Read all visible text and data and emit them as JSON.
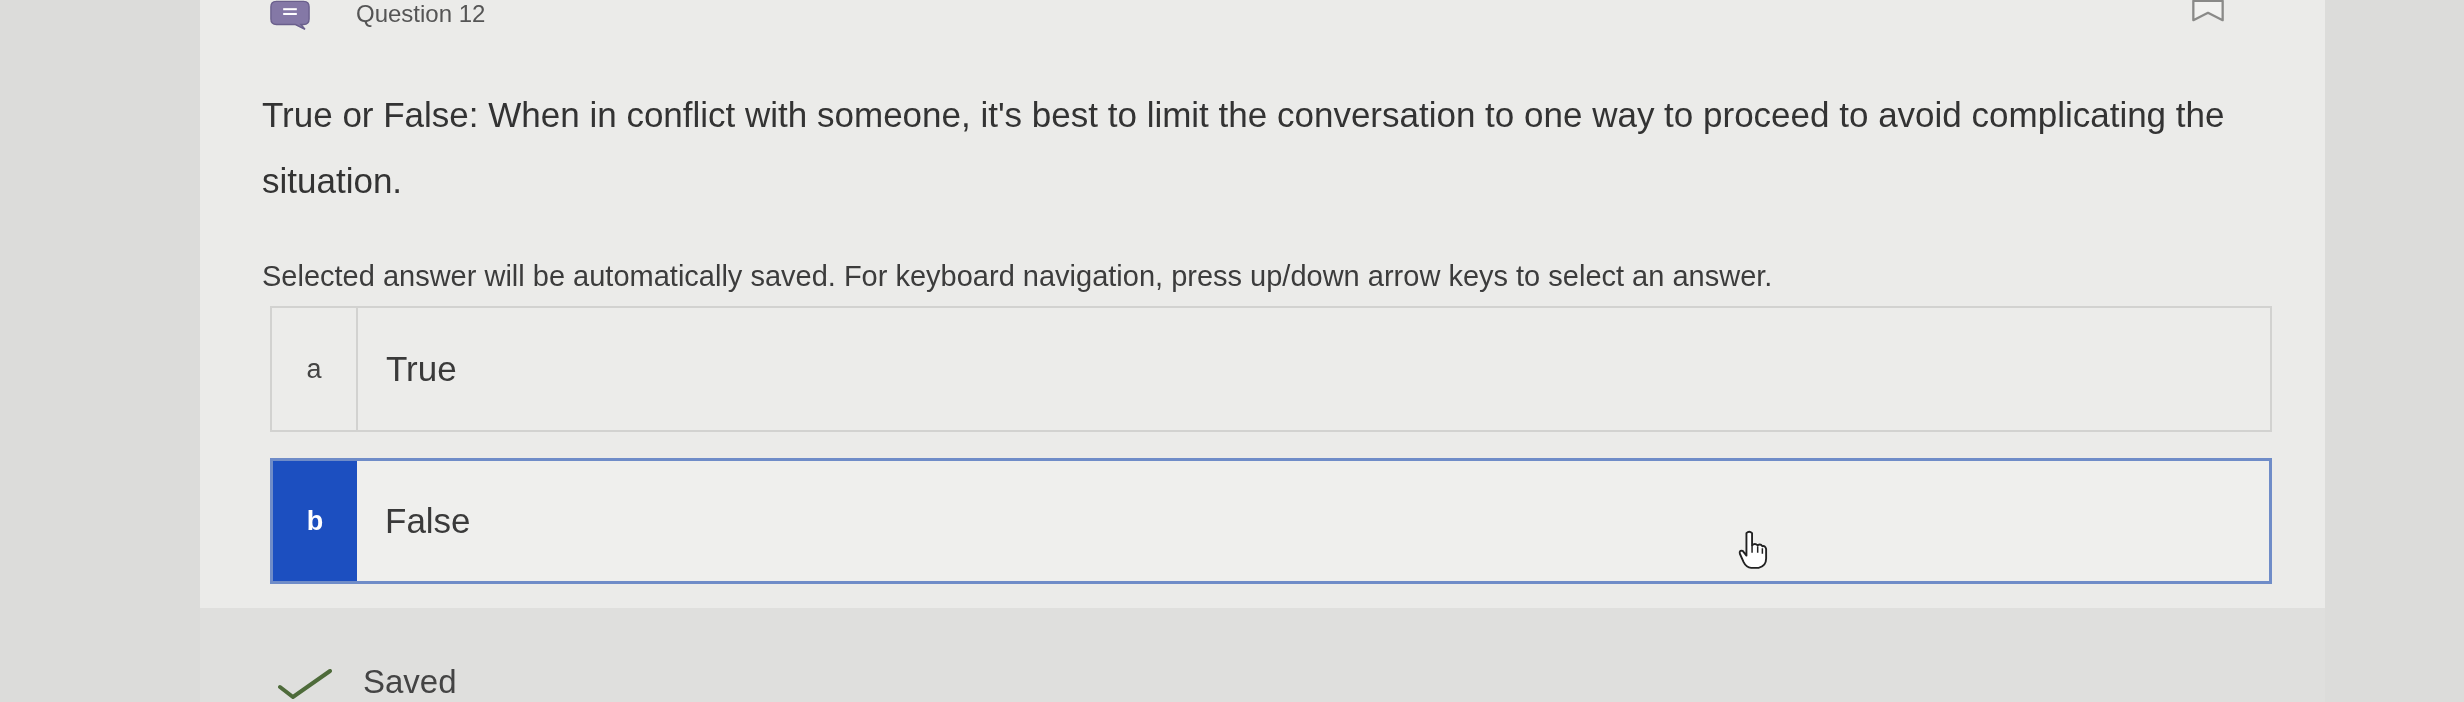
{
  "header": {
    "title": "Question 12"
  },
  "question": {
    "prompt": "True or False: When in conflict with someone, it's best to limit the conversation to one way to proceed to avoid complicating the situation.",
    "instructions": "Selected answer will be automatically saved. For keyboard navigation, press up/down arrow keys to select an answer."
  },
  "options": [
    {
      "letter": "a",
      "label": "True",
      "selected": false
    },
    {
      "letter": "b",
      "label": "False",
      "selected": true
    }
  ],
  "status": {
    "text": "Saved"
  }
}
